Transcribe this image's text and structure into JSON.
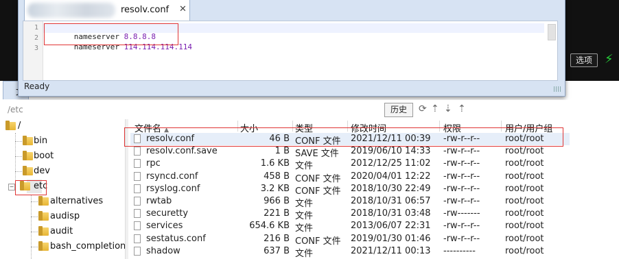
{
  "editor": {
    "tab_title": "resolv.conf",
    "tab_close": "✕",
    "lines": [
      {
        "num": "1",
        "key": "nameserver",
        "value": "8.8.8.8"
      },
      {
        "num": "2",
        "key": "nameserver",
        "value": "114.114.114.114"
      },
      {
        "num": "3",
        "key": "",
        "value": ""
      }
    ],
    "status": "Ready"
  },
  "terminal": {
    "option_button": "选项",
    "bolt_icon": "⚡"
  },
  "left_tab_label": "文",
  "pathbar": {
    "path": "/etc",
    "history_button": "历史"
  },
  "tree": {
    "root": "/",
    "items": [
      "bin",
      "boot",
      "dev",
      "etc"
    ],
    "children": [
      "alternatives",
      "audisp",
      "audit",
      "bash_completion"
    ]
  },
  "filelist": {
    "headers": {
      "name": "文件名",
      "size": "大小",
      "type": "类型",
      "mtime": "修改时间",
      "perm": "权限",
      "owner": "用户/用户组"
    },
    "rows": [
      {
        "name": "resolv.conf",
        "size": "46 B",
        "type": "CONF 文件",
        "mtime": "2021/12/11 00:39",
        "perm": "-rw-r--r--",
        "owner": "root/root"
      },
      {
        "name": "resolv.conf.save",
        "size": "1 B",
        "type": "SAVE 文件",
        "mtime": "2019/06/10 14:33",
        "perm": "-rw-r--r--",
        "owner": "root/root"
      },
      {
        "name": "rpc",
        "size": "1.6 KB",
        "type": "文件",
        "mtime": "2012/12/25 11:02",
        "perm": "-rw-r--r--",
        "owner": "root/root"
      },
      {
        "name": "rsyncd.conf",
        "size": "458 B",
        "type": "CONF 文件",
        "mtime": "2020/04/01 12:22",
        "perm": "-rw-r--r--",
        "owner": "root/root"
      },
      {
        "name": "rsyslog.conf",
        "size": "3.2 KB",
        "type": "CONF 文件",
        "mtime": "2018/10/30 22:49",
        "perm": "-rw-r--r--",
        "owner": "root/root"
      },
      {
        "name": "rwtab",
        "size": "966 B",
        "type": "文件",
        "mtime": "2018/10/31 06:57",
        "perm": "-rw-r--r--",
        "owner": "root/root"
      },
      {
        "name": "securetty",
        "size": "221 B",
        "type": "文件",
        "mtime": "2018/10/31 03:48",
        "perm": "-rw-------",
        "owner": "root/root"
      },
      {
        "name": "services",
        "size": "654.6 KB",
        "type": "文件",
        "mtime": "2013/06/07 22:31",
        "perm": "-rw-r--r--",
        "owner": "root/root"
      },
      {
        "name": "sestatus.conf",
        "size": "216 B",
        "type": "CONF 文件",
        "mtime": "2019/01/30 01:46",
        "perm": "-rw-r--r--",
        "owner": "root/root"
      },
      {
        "name": "shadow",
        "size": "637 B",
        "type": "文件",
        "mtime": "2021/12/11 00:13",
        "perm": "----------",
        "owner": "root/root"
      }
    ]
  },
  "colors": {
    "accent_red": "#e03434",
    "code_value": "#7a1fb0",
    "selection": "#e6eef9"
  }
}
